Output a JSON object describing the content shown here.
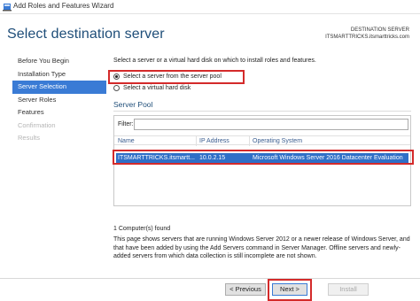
{
  "window": {
    "title": "Add Roles and Features Wizard"
  },
  "header": {
    "page_title": "Select destination server",
    "destination_label": "DESTINATION SERVER",
    "destination_value": "ITSMARTTRICKS.itsmarttricks.com"
  },
  "sidebar": {
    "items": [
      {
        "label": "Before You Begin",
        "state": "normal"
      },
      {
        "label": "Installation Type",
        "state": "normal"
      },
      {
        "label": "Server Selection",
        "state": "active"
      },
      {
        "label": "Server Roles",
        "state": "normal"
      },
      {
        "label": "Features",
        "state": "normal"
      },
      {
        "label": "Confirmation",
        "state": "disabled"
      },
      {
        "label": "Results",
        "state": "disabled"
      }
    ]
  },
  "main": {
    "intro": "Select a server or a virtual hard disk on which to install roles and features.",
    "option_pool": "Select a server from the server pool",
    "option_vhd": "Select a virtual hard disk",
    "selected_option": "pool",
    "pool_title": "Server Pool",
    "filter_label": "Filter:",
    "filter_value": "",
    "columns": [
      "Name",
      "IP Address",
      "Operating System"
    ],
    "rows": [
      {
        "name": "ITSMARTTRICKS.itsmartt...",
        "ip": "10.0.2.15",
        "os": "Microsoft Windows Server 2016 Datacenter Evaluation",
        "selected": true
      }
    ],
    "computers_found": "1 Computer(s) found",
    "description": "This page shows servers that are running Windows Server 2012 or a newer release of Windows Server, and that have been added by using the Add Servers command in Server Manager. Offline servers and newly-added servers from which data collection is still incomplete are not shown."
  },
  "footer": {
    "previous": "< Previous",
    "next": "Next >",
    "install": "Install"
  },
  "colors": {
    "accent": "#3a7bd5",
    "title_blue": "#1f4e79",
    "selection": "#2f6fc7",
    "highlight_red": "#d42a2a"
  }
}
